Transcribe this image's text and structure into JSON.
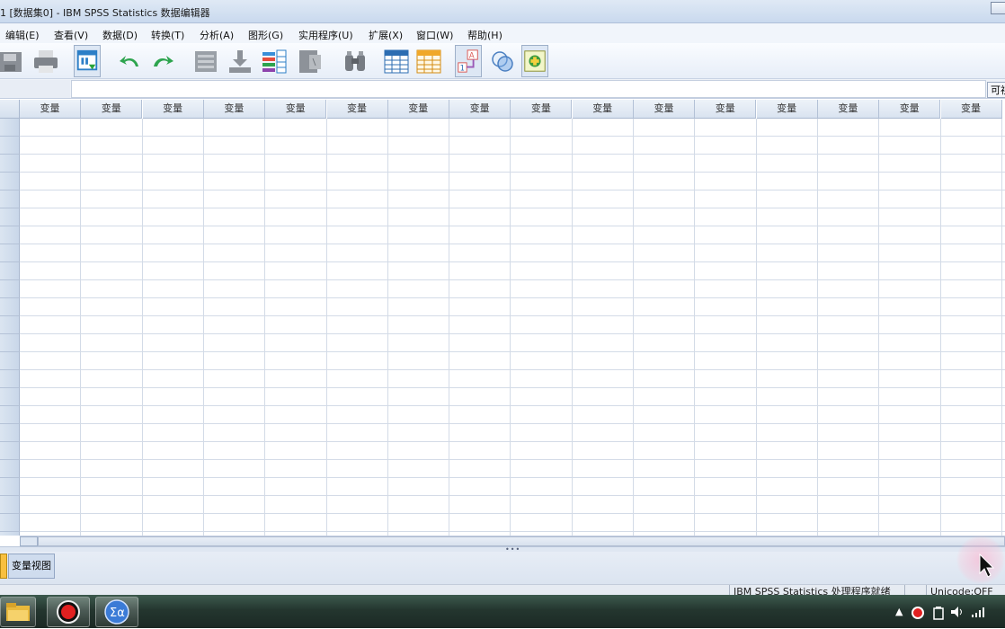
{
  "window": {
    "title": "1 [数据集0] - IBM SPSS Statistics 数据编辑器"
  },
  "menu": [
    {
      "label": "编辑(E)"
    },
    {
      "label": "查看(V)"
    },
    {
      "label": "数据(D)"
    },
    {
      "label": "转换(T)"
    },
    {
      "label": "分析(A)"
    },
    {
      "label": "图形(G)"
    },
    {
      "label": "实用程序(U)"
    },
    {
      "label": "扩展(X)"
    },
    {
      "label": "窗口(W)"
    },
    {
      "label": "帮助(H)"
    }
  ],
  "toolbar": {
    "icons": [
      "save-icon",
      "print-icon",
      "dialog-recall-icon",
      "undo-icon",
      "redo-icon",
      "goto-case-icon",
      "goto-variable-icon",
      "variables-icon",
      "run-descriptives-icon",
      "find-icon",
      "insert-cases-icon",
      "insert-variable-icon",
      "split-file-icon",
      "select-cases-icon",
      "value-labels-icon"
    ]
  },
  "cell_editor": {
    "visible_label": "可视"
  },
  "grid": {
    "column_header": "变量",
    "column_count": 16,
    "row_count": 24
  },
  "tabs": {
    "variable_view": "变量视图"
  },
  "status": {
    "processor": "IBM SPSS Statistics 处理程序就绪",
    "unicode": "Unicode:OFF"
  },
  "colors": {
    "accent": "#2c7fc7",
    "grid_line": "#d3dbe7",
    "header": "#dbe5f1"
  }
}
